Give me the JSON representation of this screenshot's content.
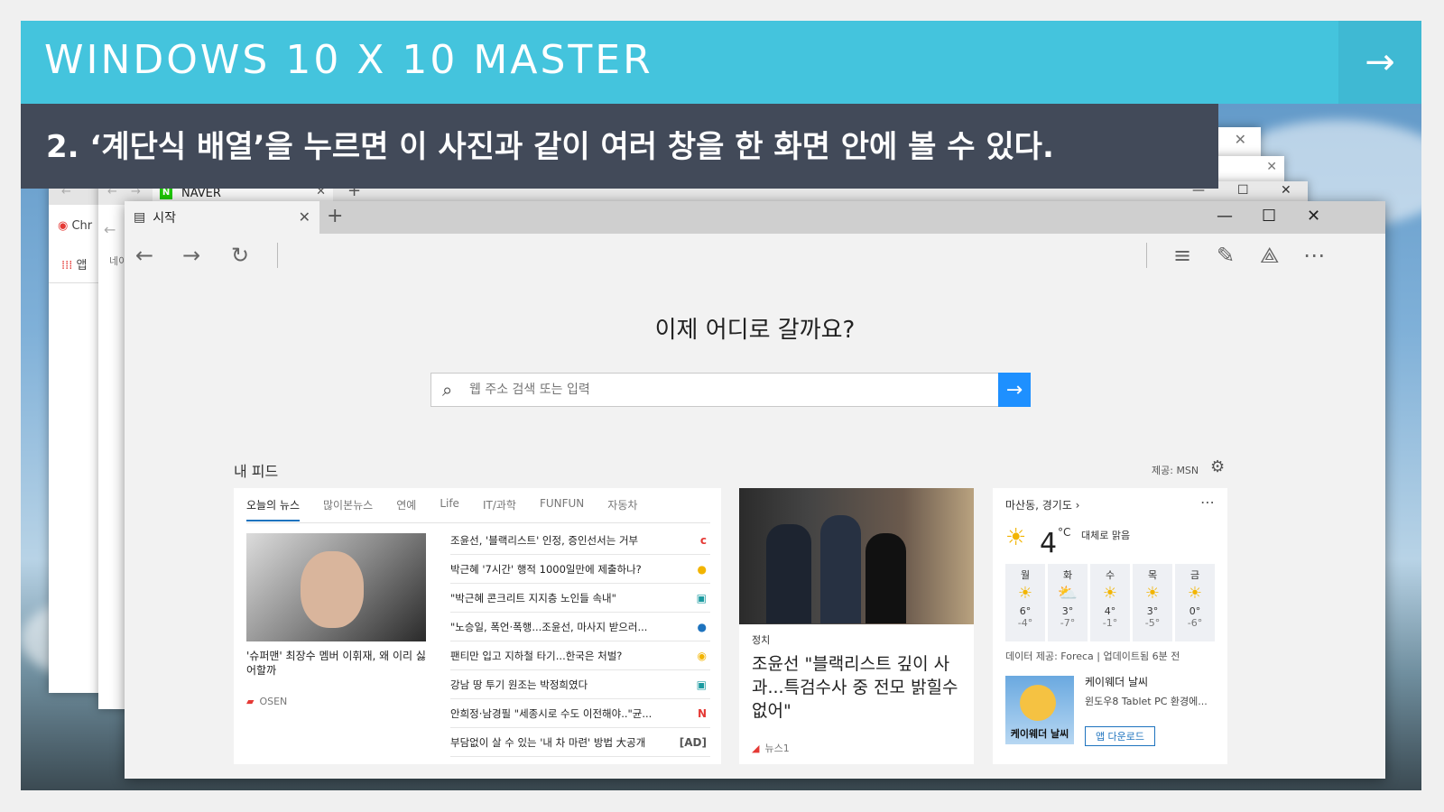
{
  "banner": {
    "title": "WINDOWS 10 X 10 MASTER",
    "arrow": "→"
  },
  "subtitle": "2. ‘계단식 배열’을 누르면 이 사진과 같이 여러 창을 한 화면 안에 볼 수 있다.",
  "back_windows": {
    "naver_tab": "NAVER",
    "chrome_tab": "Chr",
    "apps_label": "앱",
    "naver_addr": "네이"
  },
  "edge": {
    "tab_title": "시작",
    "heading": "이제 어디로 갈까요?",
    "search_placeholder": "웹 주소 검색 또는 입력",
    "feed_title": "내 피드",
    "feed_provider": "제공: MSN",
    "news_tabs": [
      "오늘의 뉴스",
      "많이본뉴스",
      "연예",
      "Life",
      "IT/과학",
      "FUNFUN",
      "자동차"
    ],
    "lead_caption": "'슈퍼맨' 최장수 멤버 이휘재, 왜 이리 싫어할까",
    "lead_source": "OSEN",
    "headlines": [
      {
        "text": "조윤선, '블랙리스트' 인정, 증인선서는 거부",
        "icon": "c",
        "color": "#e53935"
      },
      {
        "text": "박근혜 '7시간' 행적 1000일만에 제출하나?",
        "icon": "●",
        "color": "#f2b400"
      },
      {
        "text": "\"박근혜 콘크리트 지지층 노인들 속내\"",
        "icon": "▣",
        "color": "#1a9aa0"
      },
      {
        "text": "\"노승일, 폭언·폭행...조윤선, 마사지 받으러...",
        "icon": "●",
        "color": "#1e73be"
      },
      {
        "text": "팬티만 입고 지하철 타기...한국은 처벌?",
        "icon": "◉",
        "color": "#f2b400"
      },
      {
        "text": "강남 땅 투기 원조는 박정희였다",
        "icon": "▣",
        "color": "#1a9aa0"
      },
      {
        "text": "안희정·남경필 \"세종시로 수도 이전해야..\"균...",
        "icon": "N",
        "color": "#e53935"
      },
      {
        "text": "부담없이 살 수 있는 '내 차 마련' 방법 大공개",
        "icon": "[AD]",
        "color": "#555"
      }
    ],
    "story": {
      "category": "정치",
      "title": "조윤선 \"블랙리스트 깊이 사과...특검수사 중 전모 밝힐수 없어\"",
      "source": "뉴스1"
    },
    "weather": {
      "location": "마산동, 경기도 ›",
      "temp": "4",
      "unit": "°C",
      "condition": "대체로 맑음",
      "days": [
        {
          "day": "월",
          "hi": "6°",
          "lo": "-4°",
          "icon": "☀"
        },
        {
          "day": "화",
          "hi": "3°",
          "lo": "-7°",
          "icon": "⛅"
        },
        {
          "day": "수",
          "hi": "4°",
          "lo": "-1°",
          "icon": "☀"
        },
        {
          "day": "목",
          "hi": "3°",
          "lo": "-5°",
          "icon": "☀"
        },
        {
          "day": "금",
          "hi": "0°",
          "lo": "-6°",
          "icon": "☀"
        }
      ],
      "source": "데이터 제공: Foreca | 업데이트됨 6분 전",
      "app_name": "케이웨더 날씨",
      "app_desc": "윈도우8 Tablet PC 환경에...",
      "app_icon_label": "케이웨더 날씨",
      "app_button": "앱 다운로드"
    }
  }
}
